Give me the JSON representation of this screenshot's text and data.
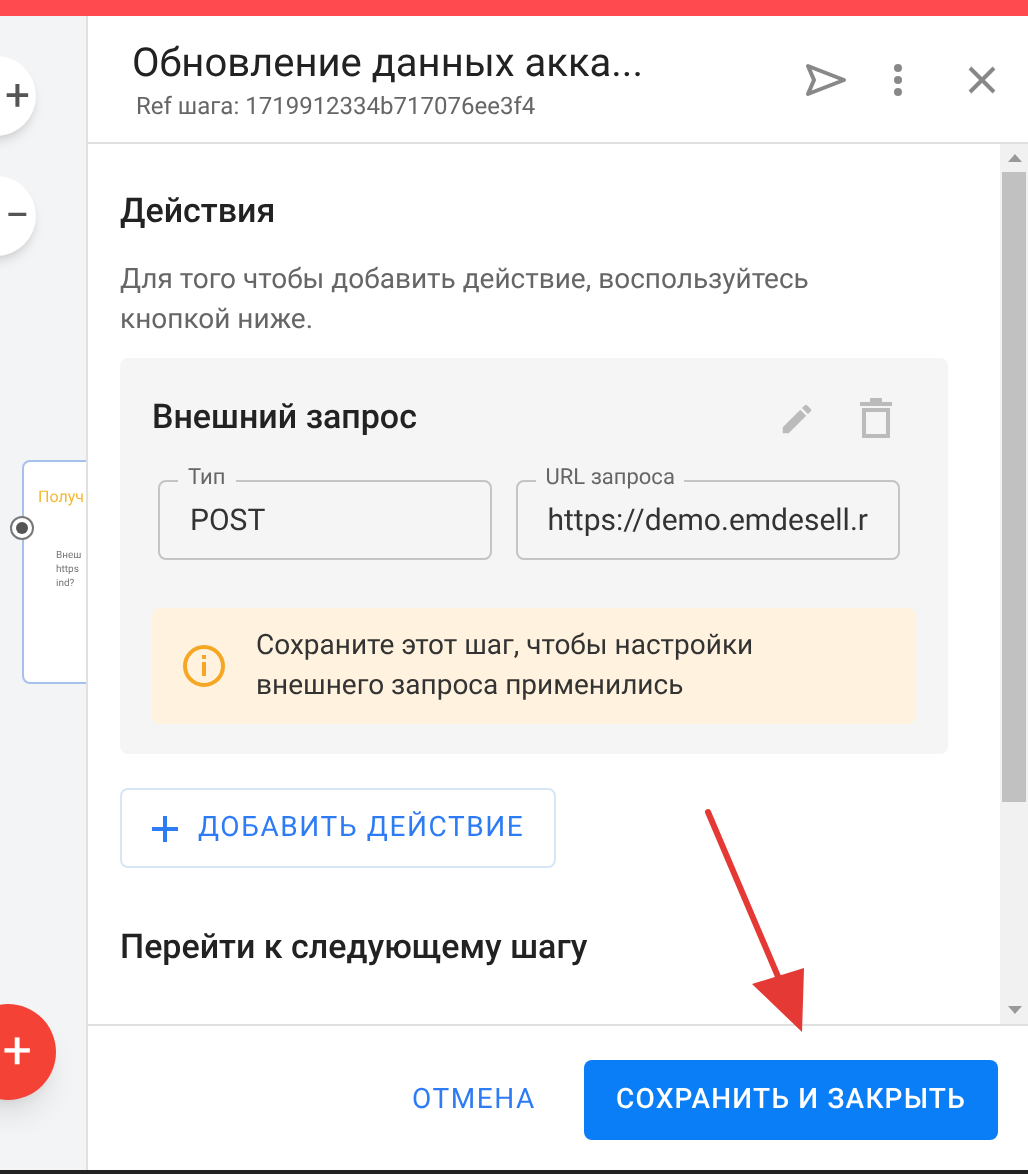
{
  "canvas": {
    "zoom_in": "+",
    "zoom_out": "−",
    "node": {
      "title": "Получ",
      "lines": [
        "Внеш",
        "https",
        "ind?"
      ]
    },
    "fab": "+"
  },
  "panel": {
    "title": "Обновление данных акка...",
    "ref": "Ref шага: 1719912334b717076ee3f4",
    "actions_heading": "Действия",
    "actions_hint": "Для того чтобы добавить действие, воспользуйтесь кнопкой ниже.",
    "action_card": {
      "title": "Внешний запрос",
      "fields": [
        {
          "label": "Тип",
          "value": "POST"
        },
        {
          "label": "URL запроса",
          "value": "https://demo.emdesell.r"
        }
      ],
      "notice": "Сохраните этот шаг, чтобы настройки внешнего запроса применились"
    },
    "add_button": "ДОБАВИТЬ ДЕЙСТВИЕ",
    "next_heading": "Перейти к следующему шагу",
    "cancel": "ОТМЕНА",
    "save": "СОХРАНИТЬ И ЗАКРЫТЬ"
  }
}
